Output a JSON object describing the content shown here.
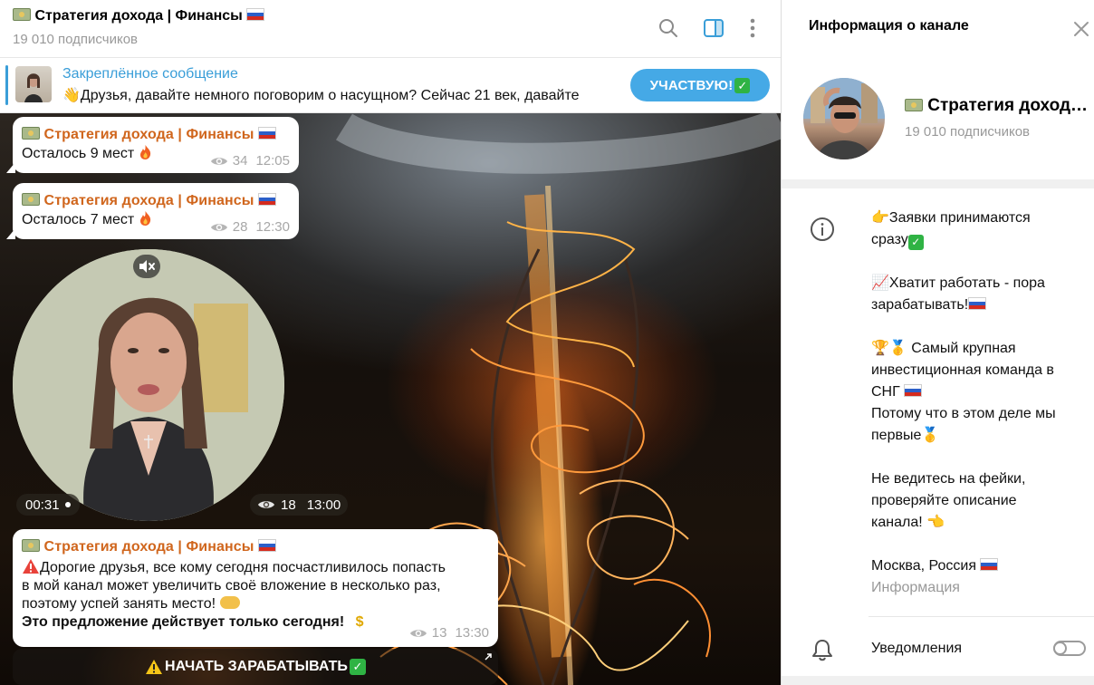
{
  "chat": {
    "title": "Стратегия дохода | Финансы",
    "subtitle": "19 010 подписчиков",
    "pinned": {
      "title": "Закреплённое сообщение",
      "text": "Друзья, давайте немного поговорим о насущном? Сейчас 21 век, давайте",
      "button_label": "УЧАСТВУЮ!"
    },
    "messages": [
      {
        "author": "Стратегия дохода | Финансы",
        "text": "Осталось 9 мест",
        "views": "34",
        "time": "12:05"
      },
      {
        "author": "Стратегия дохода | Финансы",
        "text": "Осталось 7 мест",
        "views": "28",
        "time": "12:30"
      }
    ],
    "video": {
      "duration": "00:31",
      "views": "18",
      "time": "13:00"
    },
    "post": {
      "author": "Стратегия дохода | Финансы",
      "line1": "Дорогие друзья, все кому сегодня посчастливилось попасть",
      "line2": "в мой канал может увеличить своё вложение в несколько раз,",
      "line3": "поэтому успей занять место!",
      "line4": "Это предложение действует только сегодня!",
      "views": "13",
      "time": "13:30"
    },
    "cta_label": "НАЧАТЬ ЗАРАБАТЫВАТЬ"
  },
  "info": {
    "title": "Информация о канале",
    "name": "Стратегия дохода | Финансы",
    "subscribers": "19 010 подписчиков",
    "desc": {
      "l1": "Заявки принимаются",
      "l2": "сразу",
      "l3": "Хватит работать - пора",
      "l4": "зарабатывать!",
      "l5": "Самый крупная",
      "l6": "инвестиционная команда в",
      "l7": "СНГ",
      "l8": "Потому что в этом деле мы",
      "l9": "первые",
      "l10": "Не ведитесь на фейки,",
      "l11": "проверяйте описание",
      "l12": "канала!",
      "l13": "Москва, Россия"
    },
    "desc_label": "Информация",
    "notifications_label": "Уведомления",
    "notifications_on": false
  },
  "colors": {
    "accent": "#3a9ed8",
    "button": "#45a9e6",
    "author": "#d0661d",
    "muted": "#999999"
  },
  "icons": [
    "search-icon",
    "sidebar-toggle-icon",
    "more-vertical-icon",
    "close-icon",
    "info-icon",
    "bell-icon",
    "mute-icon",
    "eye-icon",
    "share-arrow-icon"
  ]
}
